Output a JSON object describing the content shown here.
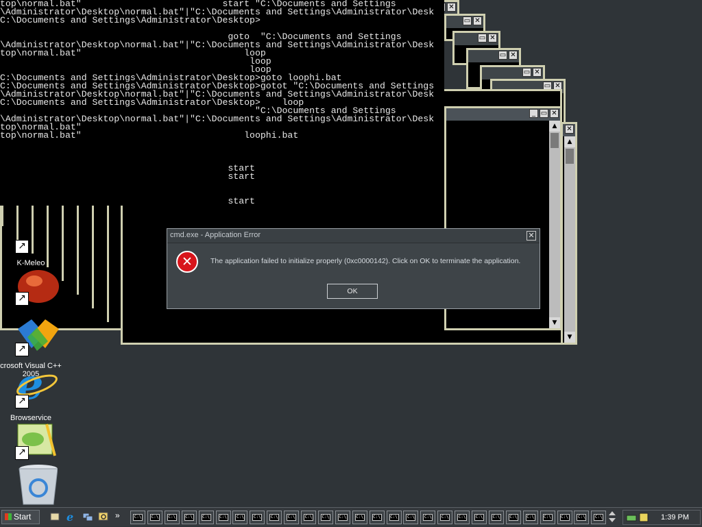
{
  "console": {
    "lines": [
      "top\\normal.bat\"                          start \"C:\\Documents and Settings",
      "\\Administrator\\Desktop\\normal.bat\"|\"C:\\Documents and Settings\\Administrator\\Desk",
      "C:\\Documents and Settings\\Administrator\\Desktop>",
      "",
      "                                          goto  \"C:\\Documents and Settings",
      "\\Administrator\\Desktop\\normal.bat\"|\"C:\\Documents and Settings\\Administrator\\Desk",
      "top\\normal.bat\"                              loop",
      "                                              loop",
      "                                              loop",
      "C:\\Documents and Settings\\Administrator\\Desktop>goto loophi.bat",
      "C:\\Documents and Settings\\Administrator\\Desktop>gotot \"C:\\Documents and Settings",
      "\\Administrator\\Desktop\\normal.bat\"|\"C:\\Documents and Settings\\Administrator\\Desk",
      "C:\\Documents and Settings\\Administrator\\Desktop>    loop",
      "                                               \"C:\\Documents and Settings",
      "\\Administrator\\Desktop\\normal.bat\"|\"C:\\Documents and Settings\\Administrator\\Desk",
      "top\\normal.bat\"",
      "top\\normal.bat\"                              loophi.bat",
      "",
      "",
      "",
      "                                          start",
      "                                          start",
      "",
      "",
      "                                          start"
    ]
  },
  "desktop_icons": [
    {
      "label": "K-Meleo",
      "icon": "k-meleo-red-ball-icon"
    },
    {
      "label": "",
      "icon": "visual-studio-logo-icon"
    },
    {
      "label": "crosoft Visual C++ 2005",
      "icon": "visual-cpp-label"
    },
    {
      "label": "Browservice",
      "icon": "internet-explorer-icon"
    },
    {
      "label": "",
      "icon": "notepad-frog-icon"
    },
    {
      "label": "",
      "icon": "recycle-bin-icon"
    }
  ],
  "dialog": {
    "title": "cmd.exe - Application Error",
    "message": "The application failed to initialize properly (0xc0000142). Click on OK to terminate the application.",
    "ok_label": "OK",
    "close_label": "✕",
    "icon": "error-x-icon"
  },
  "taskbar": {
    "start_label": "Start",
    "quick_launch": [
      "show-desktop-icon",
      "internet-explorer-icon",
      "network-icon",
      "search-icon"
    ],
    "overflow_label": "»",
    "cmd_button_glyph": "C:\\",
    "cmd_button_count": 28,
    "clock": "1:39 PM"
  },
  "colors": {
    "desktop": "#2f3438",
    "error_red": "#d8151b",
    "window_frame": "#cfcfb0"
  }
}
